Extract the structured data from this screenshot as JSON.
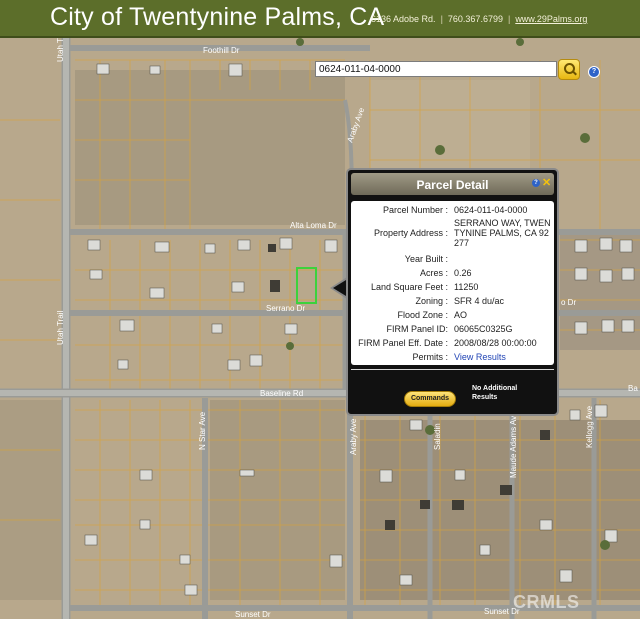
{
  "header": {
    "title": "City of Twentynine Palms, CA",
    "address": "6136 Adobe Rd.",
    "phone": "760.367.6799",
    "website": "www.29Palms.org"
  },
  "search": {
    "value": "0624-011-04-0000"
  },
  "map": {
    "roads": [
      "Utah Tr",
      "Foothill Dr",
      "Araby Ave",
      "Alta Loma Dr",
      "Serrano Dr",
      "Utah Trail",
      "Baseline Rd",
      "N Star Ave",
      "Araby Ave",
      "Saladin",
      "Maude Adams Ave",
      "Kellogg Ave",
      "Sunset Dr",
      "Sunset Dr",
      "o Dr",
      "Ba"
    ]
  },
  "popup": {
    "title": "Parcel Detail",
    "fields": [
      {
        "label": "Parcel Number :",
        "value": "0624-011-04-0000"
      },
      {
        "label": "Property Address :",
        "value": "SERRANO WAY, TWENTYNINE PALMS, CA 92277"
      },
      {
        "label": "Year Built :",
        "value": ""
      },
      {
        "label": "Acres :",
        "value": "0.26"
      },
      {
        "label": "Land Square Feet :",
        "value": "11250"
      },
      {
        "label": "Zoning :",
        "value": "SFR 4 du/ac"
      },
      {
        "label": "Flood Zone :",
        "value": "AO"
      },
      {
        "label": "FIRM Panel ID:",
        "value": "06065C0325G"
      },
      {
        "label": "FIRM Panel Eff. Date :",
        "value": "2008/08/28 00:00:00"
      },
      {
        "label": "Permits :",
        "value": "View Results"
      }
    ],
    "commands_label": "Commands",
    "no_results": "No Additional Results"
  },
  "watermark": "CRMLS",
  "colors": {
    "header_bg": "#5c6e2a",
    "parcel_lines": "#d9a43a",
    "selected_parcel": "#3cd23c",
    "link": "#2144b5",
    "button_yellow": "#f0c21a"
  }
}
